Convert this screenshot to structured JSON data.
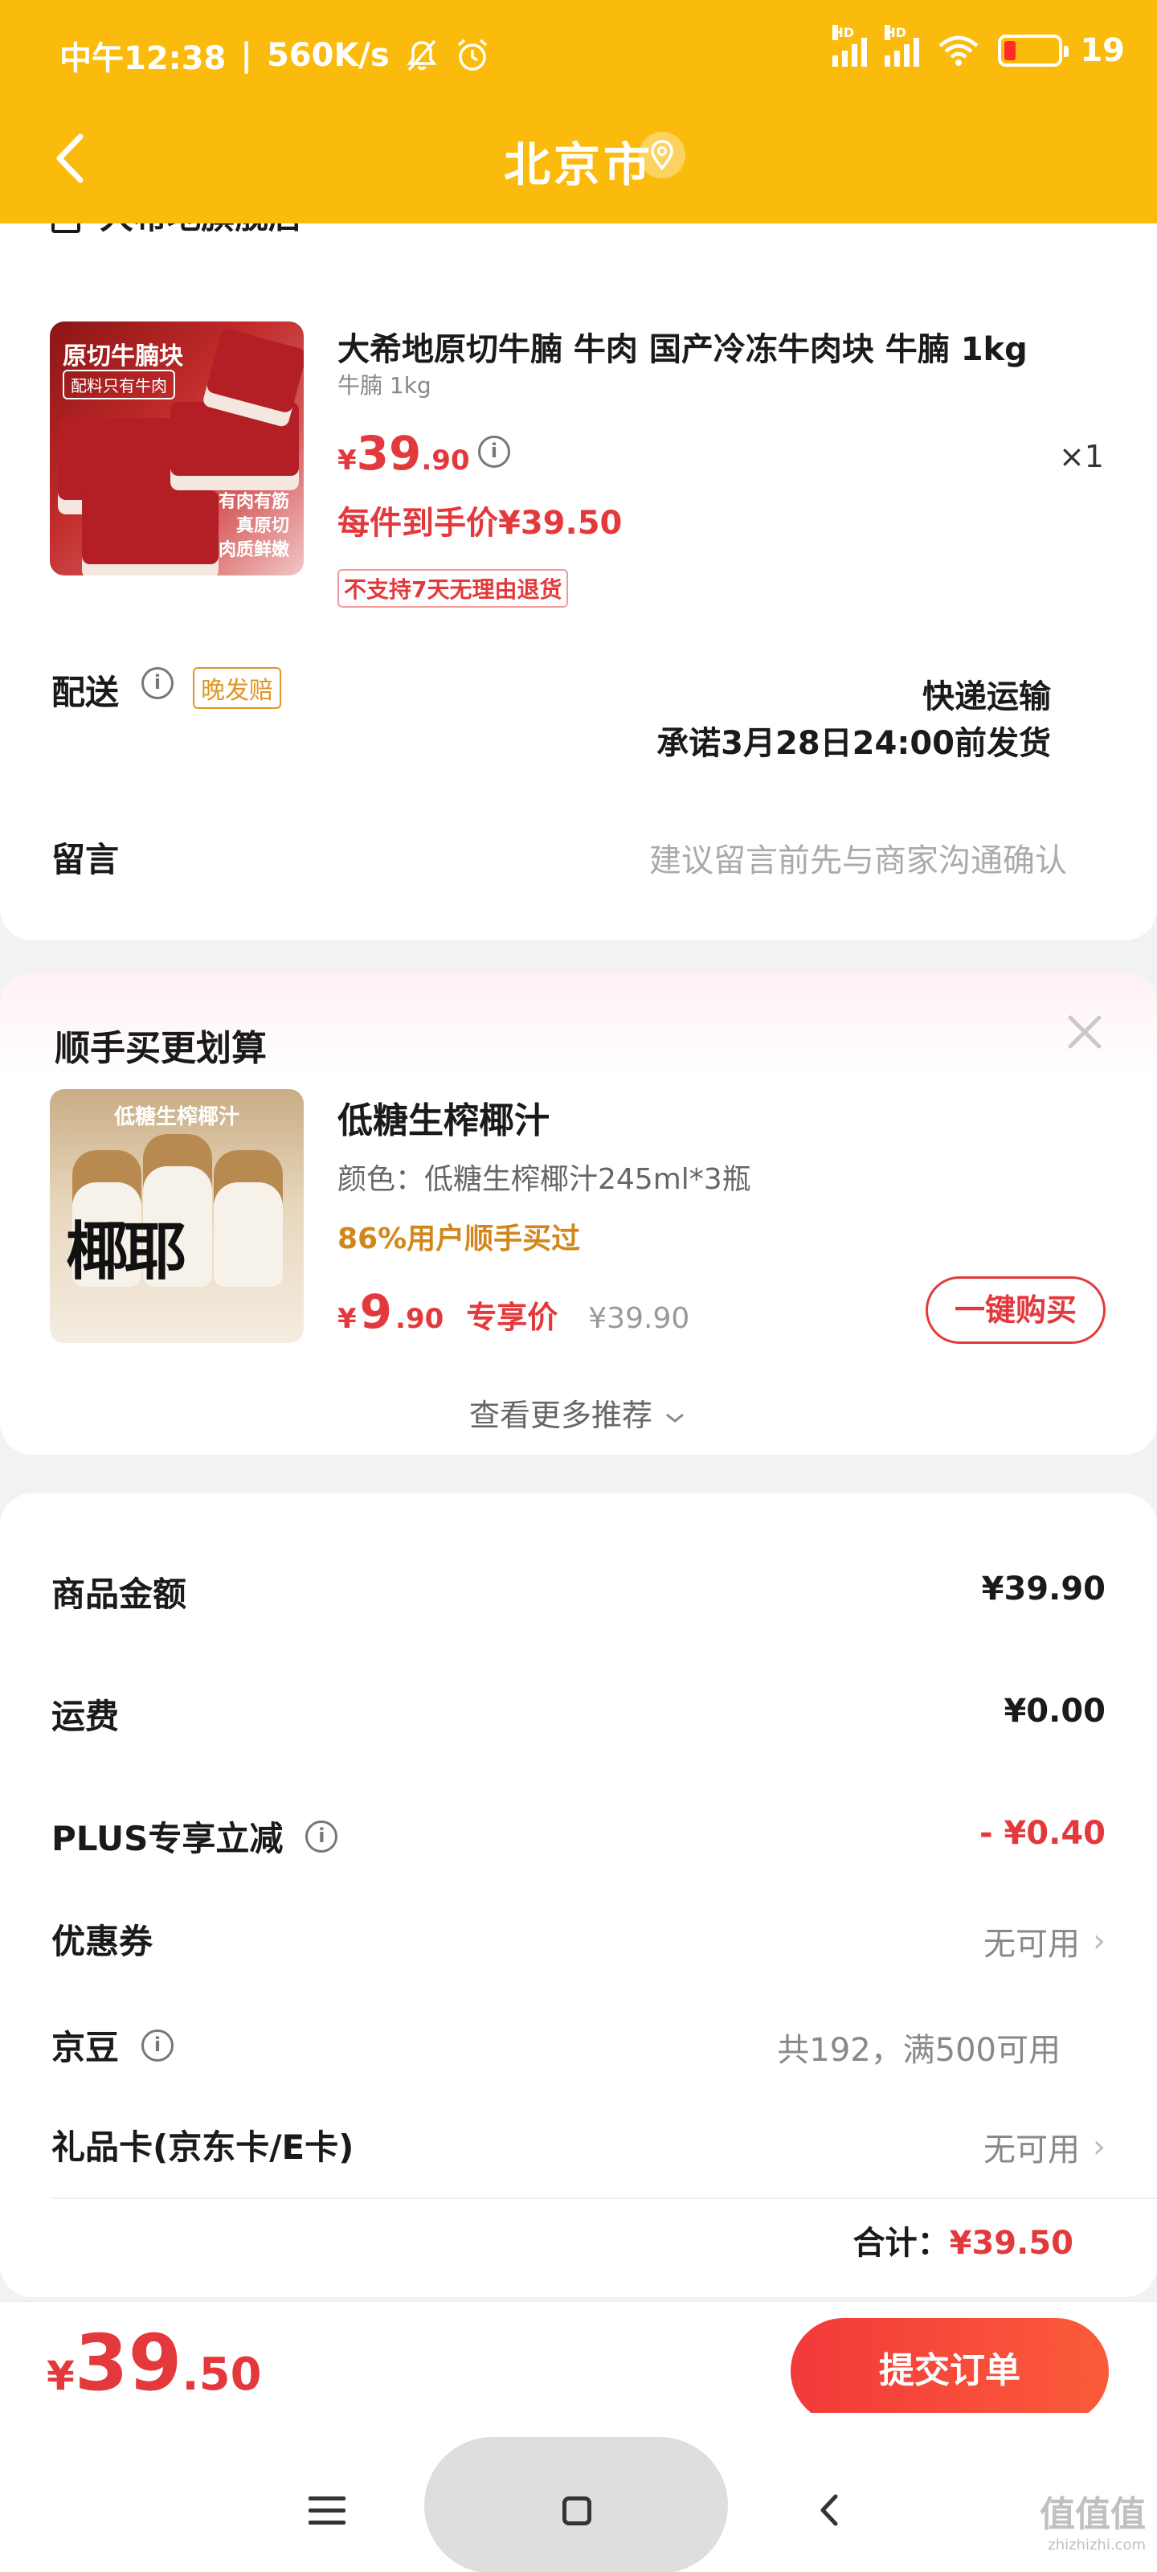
{
  "status_bar": {
    "time": "中午12:38",
    "speed": "560K/s",
    "network_hd": "HD",
    "battery": "19"
  },
  "nav": {
    "title": "北京市",
    "back_icon": "chevron-left-icon",
    "location_icon": "location-pin-icon"
  },
  "order": {
    "store_name": "大希地旗舰店",
    "product": {
      "title": "大希地原切牛腩 牛肉 国产冷冻牛肉块 牛腩 1kg",
      "spec": "牛腩 1kg",
      "price_currency": "¥",
      "price_int": "39",
      "price_dec": ".90",
      "quantity": "×1",
      "final_price": "每件到手价¥39.50",
      "return_policy": "不支持7天无理由退货",
      "image_text": {
        "title": "原切牛腩块",
        "subtitle": "配料只有牛肉",
        "line1": "有肉有筋",
        "line2": "真原切",
        "line3": "肉质鲜嫩"
      }
    },
    "delivery": {
      "label": "配送",
      "badge": "晚发赔",
      "method": "快递运输",
      "promise": "承诺3月28日24:00前发货"
    },
    "message": {
      "label": "留言",
      "placeholder": "建议留言前先与商家沟通确认"
    }
  },
  "recommend": {
    "title": "顺手买更划算",
    "product": {
      "name": "低糖生榨椰汁",
      "spec": "颜色：低糖生榨椰汁245ml*3瓶",
      "stat": "86%用户顺手买过",
      "price_currency": "¥",
      "price_int": "9",
      "price_dec": ".90",
      "exclusive_label": "专享价",
      "original_price": "¥39.90",
      "image_text": {
        "header": "低糖生榨椰汁",
        "brand": "椰耶"
      }
    },
    "buy_button": "一键购买",
    "more": "查看更多推荐"
  },
  "summary": {
    "rows": [
      {
        "label": "商品金额",
        "value": "¥39.90"
      },
      {
        "label": "运费",
        "value": "¥0.00"
      },
      {
        "label": "PLUS专享立减",
        "value": "- ¥0.40"
      },
      {
        "label": "优惠券",
        "value": "无可用"
      },
      {
        "label": "京豆",
        "value": "共192，满500可用"
      },
      {
        "label": "礼品卡(京东卡/E卡)",
        "value": "无可用"
      }
    ],
    "total_label": "合计：",
    "total_value": "¥39.50"
  },
  "bottom": {
    "price_currency": "¥",
    "price_int": "39",
    "price_dec": ".50",
    "submit": "提交订单"
  },
  "watermark": {
    "text": "值值值",
    "url": "zhizhizhi.com"
  },
  "colors": {
    "header": "#fbbb0c",
    "accent_red": "#e4393c",
    "orange": "#d1871c"
  }
}
